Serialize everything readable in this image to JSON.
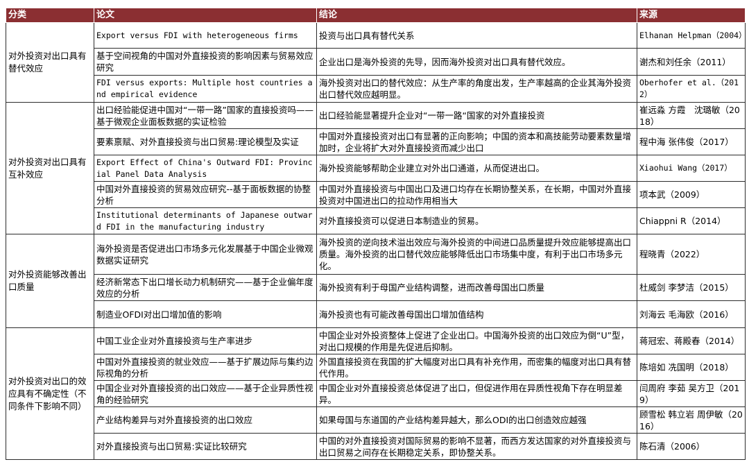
{
  "headers": [
    "分类",
    "论文",
    "结论",
    "来源"
  ],
  "groups": [
    {
      "category": "对外投资对出口具有替代效应",
      "rows": [
        {
          "paper": "Export versus FDI with heterogeneous firms",
          "conclusion": "投资与出口具有替代关系",
          "source": "Elhanan Helpman（2004）",
          "en": true
        },
        {
          "paper": "基于空间视角的中国对外直接投资的影响因素与贸易效应研究",
          "conclusion": "企业出口是海外投资的先导，因而海外投资对出口具有替代效应。",
          "source": "谢杰和刘任余（2011）"
        },
        {
          "paper": "FDI versus exports: Multiple host countries and empirical evidence",
          "conclusion": "海外投资对出口的替代效应：从生产率的角度出发，生产率越高的企业其海外投资出口替代效应越明显。",
          "source": "Oberhofer et al.（2012）",
          "en": true
        }
      ]
    },
    {
      "category": "对外投资对出口具有互补效应",
      "rows": [
        {
          "paper": "出口经验能促进中国对“一带一路”国家的直接投资吗——基于微观企业面板数据的实证检验",
          "conclusion": "出口经验能显著提升企业对“一带一路“国家的对外直接投资",
          "source": "崔远淼 方霞　沈璐敏（2018）"
        },
        {
          "paper": "要素禀赋、对外直接投资与出口贸易:理论模型及实证",
          "conclusion": "中国对外直接投资对出口有显著的正向影响；中国的资本和高技能劳动要素数量增加时，企业将扩大对外直接投资而减少出口",
          "source": "程中海 张伟俊（2017）"
        },
        {
          "paper": "Export Effect of China's Outward FDI: Provincial Panel Data Analysis",
          "conclusion": "海外投资能够帮助企业建立对外出口通道，从而促进出口。",
          "source": "Xiaohui Wang（2017）",
          "en": true
        },
        {
          "paper": "中国对外直接投资的贸易效应研究--基于面板数据的协整分析",
          "conclusion": "中国对外直接投资与中国出口及进口均存在长期协整关系，在长期，中国对外直接投资对中国进出口的拉动作用相当大",
          "source": "项本武（2009）"
        },
        {
          "paper": "Institutional determinants of Japanese outward FDI in the manufacturing industry",
          "conclusion": "对外直接投资可以促进日本制造业的贸易。",
          "source": "Chiappni R（2014）",
          "en": true
        }
      ]
    },
    {
      "category": "对外投资能够改善出口质量",
      "rows": [
        {
          "paper": "海外投资是否促进出口市场多元化发展基于中国企业微观数据实证研究",
          "conclusion": "海外投资的逆向技术溢出效应与海外投资的中间进口品质量提升效应能够提高出口质量。海外投资的出口替代效应能够降低出口市场集中度，有利于出口市场多元化。",
          "source": "程晓青（2022）"
        },
        {
          "paper": "经济新常态下出口增长动力机制研究——基于企业偏年度效应的分析",
          "conclusion": "海外投资有利于母国产业结构调整，进而改善母国出口质量",
          "source": "杜威剑 李梦洁（2015）"
        },
        {
          "paper": "制造业OFDI对出口增加值的影响",
          "conclusion": "海外投资也有可能改善母国出口增加值结构",
          "source": "刘海云 毛海欧（2016）"
        }
      ]
    },
    {
      "category": "对外投资对出口的效应具有不确定性（不同条件下影响不同）",
      "rows": [
        {
          "paper": "中国工业企业对外直接投资与生产率进步",
          "conclusion": "中国企业对外投资整体上促进了企业出口。中国海外投资的出口效应为倒“U”型，对出口规模的作用是先促进后抑制。",
          "source": "蒋冠宏、蒋殿春（2014）"
        },
        {
          "paper": "中国对外直接投资的就业效应——基于扩展边际与集约边际视角的分析",
          "conclusion": "外国直接投资在我国的扩大幅度对出口具有补充作用，而密集的幅度对出口具有替代作用。",
          "source": "陈培如 冼国明（2018）"
        },
        {
          "paper": "中国企业对外直接投资的出口效应——基于企业异质性视角的经验研究",
          "conclusion": "中国企业对外直接投资总体促进了出口，但促进作用在异质性视角下存在明显差异。",
          "source": "闫周府 李茹 吴方卫（2019）"
        },
        {
          "paper": "产业结构差异与对外直接投资的出口效应",
          "conclusion": "如果母国与东道国的产业结构差异越大，那么ODI的出口创造效应越强",
          "source": "顾雪松 韩立岩 周伊敏（2016）"
        },
        {
          "paper": "对外直接投资与出口贸易:实证比较研究",
          "conclusion": "中国的对外直接投资对国际贸易的影响不显著，而西方发达国家的对外直接投资与出口贸易之间存在长期稳定关系，即协整关系。",
          "source": "陈石清（2006）"
        }
      ]
    }
  ]
}
